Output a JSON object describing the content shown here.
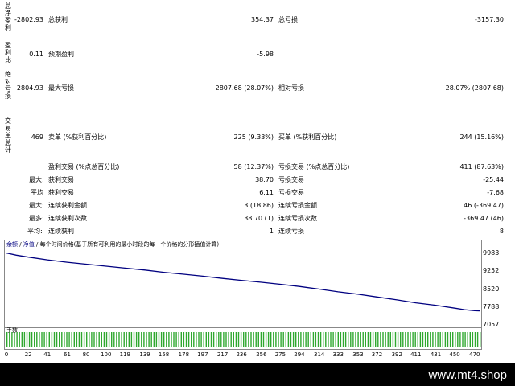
{
  "stats": {
    "side_labels": [
      {
        "text": "总净盈利",
        "top": 3
      },
      {
        "text": "盈利比",
        "top": 52
      },
      {
        "text": "绝对亏损",
        "top": 88
      },
      {
        "text": "交易单总计",
        "top": 146
      }
    ],
    "row1": {
      "left_value": "-2802.93",
      "mid_label": "总获利",
      "mid_value": "354.37",
      "right_label": "总亏损",
      "right_value": "-3157.30"
    },
    "row2": {
      "left_value": "0.11",
      "mid_label": "预期盈利",
      "mid_value": "-5.98"
    },
    "row3": {
      "left_value": "2804.93",
      "mid_label": "最大亏损",
      "mid_value": "2807.68 (28.07%)",
      "right_label": "相对亏损",
      "right_value": "28.07% (2807.68)"
    },
    "row4": {
      "left_value": "469",
      "mid_label": "卖单 (%获利百分比)",
      "mid_value": "225 (9.33%)",
      "right_label": "买单 (%获利百分比)",
      "right_value": "244 (15.16%)"
    },
    "row5": {
      "mid_label": "盈利交易 (%点总百分比)",
      "mid_value": "58 (12.37%)",
      "right_label": "亏损交易 (%点总百分比)",
      "right_value": "411 (87.63%)"
    },
    "row6": {
      "prefix": "最大:",
      "mid_label": "获利交易",
      "mid_value": "38.70",
      "right_label": "亏损交易",
      "right_value": "-25.44"
    },
    "row7": {
      "prefix": "平均",
      "mid_label": "获利交易",
      "mid_value": "6.11",
      "right_label": "亏损交易",
      "right_value": "-7.68"
    },
    "row8": {
      "prefix": "最大:",
      "mid_label": "连续获利金额",
      "mid_value": "3 (18.86)",
      "right_label": "连续亏损金额",
      "right_value": "46 (-369.47)"
    },
    "row9": {
      "prefix": "最多:",
      "mid_label": "连续获利次数",
      "mid_value": "38.70 (1)",
      "right_label": "连续亏损次数",
      "right_value": "-369.47 (46)"
    },
    "row10": {
      "prefix": "平均:",
      "mid_label": "连续获利",
      "mid_value": "1",
      "right_label": "连续亏损",
      "right_value": "8"
    }
  },
  "chart": {
    "tabs": [
      "余额",
      "净值",
      "每个时间价格(基于所有可利用的最小时段的每一个价格的分形插值计算)"
    ],
    "volume_label": "手数"
  },
  "chart_data": {
    "type": "line",
    "title": "",
    "xlabel": "",
    "ylabel": "",
    "x_ticks": [
      0,
      22,
      41,
      61,
      80,
      100,
      119,
      139,
      158,
      178,
      197,
      217,
      236,
      256,
      275,
      294,
      314,
      333,
      353,
      372,
      392,
      411,
      431,
      450,
      470
    ],
    "y_ticks": [
      9983,
      9252,
      8520,
      7788,
      7057
    ],
    "xlim": [
      0,
      475
    ],
    "ylim": [
      7057,
      10150
    ],
    "color": "#000080",
    "series": [
      {
        "x": [
          0,
          10,
          22,
          41,
          61,
          80,
          100,
          119,
          139,
          158,
          178,
          197,
          217,
          236,
          256,
          275,
          294,
          314,
          333,
          353,
          372,
          392,
          411,
          431,
          450,
          460,
          470,
          475
        ],
        "values": [
          10000,
          9910,
          9830,
          9720,
          9620,
          9540,
          9460,
          9380,
          9300,
          9210,
          9130,
          9050,
          8960,
          8880,
          8800,
          8720,
          8630,
          8520,
          8410,
          8310,
          8200,
          8080,
          7960,
          7860,
          7740,
          7680,
          7640,
          7630
        ]
      }
    ]
  },
  "footer": {
    "url": "www.mt4.shop"
  }
}
